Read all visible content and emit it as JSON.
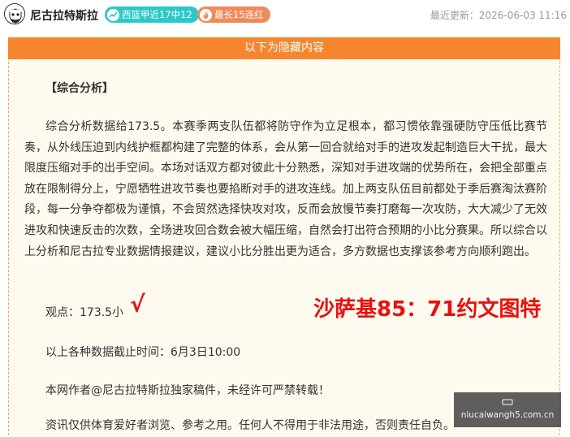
{
  "header": {
    "author_name": "尼古拉特斯拉",
    "badges": [
      {
        "label": "西篮甲近17中12",
        "icon": "trend-icon",
        "color": "#2cc8c8"
      },
      {
        "label": "最长15连红",
        "icon": "flame-icon",
        "color": "#f08a5a"
      }
    ],
    "updated_text": "最近更新：2026-06-03 11:16"
  },
  "content": {
    "banner": "以下为隐藏内容",
    "section_title": "【综合分析】",
    "paragraph": "综合分析数据给173.5。本赛季两支队伍都将防守作为立足根本，都习惯依靠强硬防守压低比赛节奏，从外线压迫到内线护框都构建了完整的体系，会从第一回合就给对手的进攻发起制造巨大干扰，最大限度压缩对手的出手空间。本场对话双方都对彼此十分熟悉，深知对手进攻端的优势所在，会把全部重点放在限制得分上，宁愿牺牲进攻节奏也要掐断对手的进攻连线。加上两支队伍目前都处于季后赛淘汰赛阶段，每一分争夺都极为谨慎，不会贸然选择快攻对攻，反而会放慢节奏打磨每一次攻防，大大减少了无效进攻和快速反击的次数，全场进攻回合数会被大幅压缩，自然会打出符合预期的小比分赛果。所以综合以上分析和尼古拉专业数据情报建议，建议小比分胜出更为适合，多方数据也支撑该参考方向顺利跑出。",
    "opinion": "观点：173.5小",
    "check_mark": "√",
    "promo_text": "沙萨基85：71约文图特",
    "deadline": "以上各种数据截止时间：6月3日10:00",
    "notice": "本网作者@尼古拉特斯拉独家稿件，未经许可严禁转载！",
    "disclaimer": "资讯仅供体育爱好者浏览、参考之用。任何人不得用于非法用途，否则责任自负。"
  },
  "watermark": {
    "url": "niucaiwangh5.com.cn"
  },
  "colors": {
    "accent_orange": "#f6862e",
    "panel_bg": "#fffaef",
    "highlight_red": "#e81010"
  }
}
